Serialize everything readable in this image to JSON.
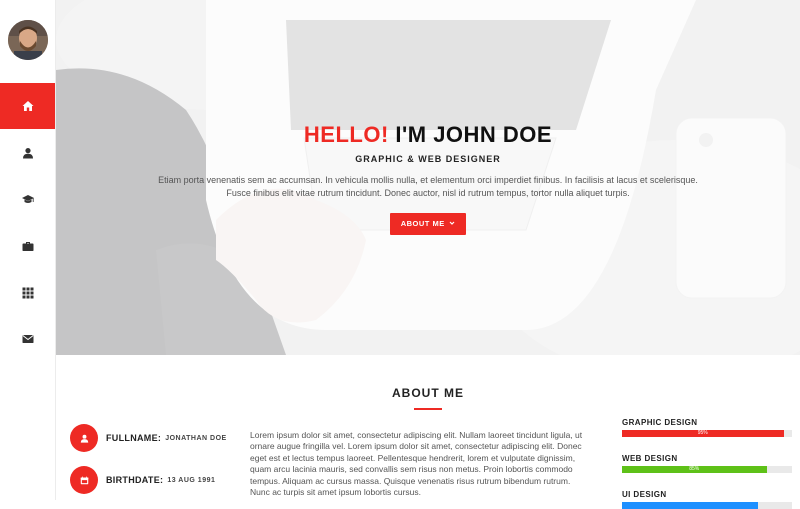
{
  "sidebar": {
    "items": [
      {
        "icon": "home-icon",
        "active": true
      },
      {
        "icon": "user-icon",
        "active": false
      },
      {
        "icon": "graduation-cap-icon",
        "active": false
      },
      {
        "icon": "briefcase-icon",
        "active": false
      },
      {
        "icon": "grid-icon",
        "active": false
      },
      {
        "icon": "envelope-icon",
        "active": false
      }
    ]
  },
  "hero": {
    "title_highlight": "HELLO!",
    "title_rest": "I'M JOHN DOE",
    "subtitle": "GRAPHIC & WEB DESIGNER",
    "text_line1": "Etiam porta venenatis sem ac accumsan. In vehicula mollis nulla, et elementum orci imperdiet finibus. In facilisis at lacus et scelerisque.",
    "text_line2": "Fusce finibus elit vitae rutrum tincidunt. Donec auctor, nisl id rutrum tempus, tortor nulla aliquet turpis.",
    "button_label": "ABOUT ME",
    "button_icon": "chevron-down-icon"
  },
  "about": {
    "title": "ABOUT ME",
    "info": [
      {
        "label": "FULLNAME:",
        "value": "JONATHAN DOE",
        "icon": "user-icon"
      },
      {
        "label": "BIRTHDATE:",
        "value": "13 AUG 1991",
        "icon": "calendar-icon"
      }
    ],
    "text": "Lorem ipsum dolor sit amet, consectetur adipiscing elit. Nullam laoreet tincidunt ligula, ut ornare augue fringilla vel. Lorem ipsum dolor sit amet, consectetur adipiscing elit. Donec eget est et lectus tempus laoreet. Pellentesque hendrerit, lorem et vulputate dignissim, quam arcu lacinia mauris, sed convallis sem risus non metus. Proin lobortis commodo tempus. Aliquam ac cursus massa. Quisque venenatis risus rutrum bibendum rutrum. Nunc ac turpis sit amet ipsum lobortis cursus."
  },
  "skills": [
    {
      "name": "GRAPHIC DESIGN",
      "percent": 95,
      "label": "95%",
      "color": "#ee2a24"
    },
    {
      "name": "WEB DESIGN",
      "percent": 85,
      "label": "85%",
      "color": "#5ec118"
    },
    {
      "name": "UI DESIGN",
      "percent": 80,
      "label": "",
      "color": "#1e90ff"
    }
  ],
  "colors": {
    "accent": "#ee2a24",
    "green": "#5ec118"
  }
}
